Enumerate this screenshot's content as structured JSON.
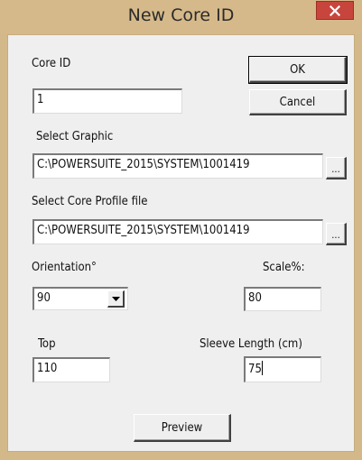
{
  "window": {
    "title": "New Core ID",
    "close_glyph": "✕"
  },
  "core_id": {
    "label": "Core ID",
    "value": "1"
  },
  "buttons": {
    "ok": "OK",
    "cancel": "Cancel",
    "browse": "...",
    "preview": "Preview"
  },
  "graphic": {
    "label": "Select Graphic",
    "value": "C:\\POWERSUITE_2015\\SYSTEM\\1001419"
  },
  "core_profile": {
    "label": "Select Core Profile file",
    "value": "C:\\POWERSUITE_2015\\SYSTEM\\1001419"
  },
  "orientation": {
    "label": "Orientation°",
    "value": "90"
  },
  "scale": {
    "label": "Scale%:",
    "value": "80"
  },
  "top": {
    "label": "Top",
    "value": "110"
  },
  "sleeve_length": {
    "label": "Sleeve Length (cm)",
    "value": "75"
  },
  "colors": {
    "titlebar": "#d6b98a",
    "client": "#efefef",
    "close_button": "#c7453d"
  },
  "icons": {
    "close": "close-icon",
    "dropdown": "chevron-down-icon"
  }
}
